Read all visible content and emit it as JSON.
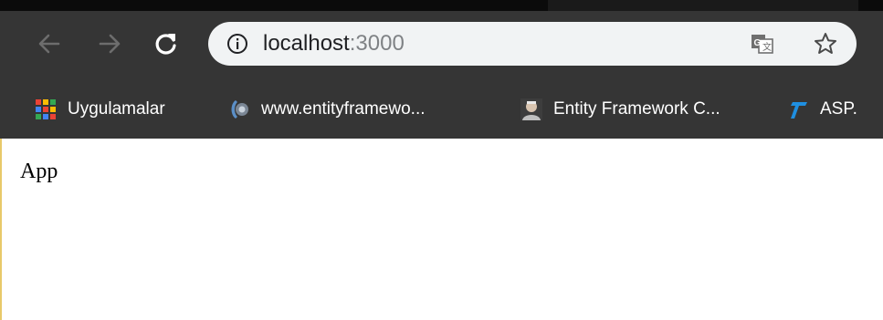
{
  "browser": {
    "address_bar": {
      "host": "localhost",
      "port": ":3000",
      "info_icon": "info-icon",
      "translate_icon": "translate-icon",
      "star_icon": "star-icon"
    },
    "nav": {
      "back_icon": "back-arrow-icon",
      "forward_icon": "forward-arrow-icon",
      "reload_icon": "reload-icon"
    },
    "bookmarks": [
      {
        "label": "Uygulamalar",
        "icon": "apps-grid-icon"
      },
      {
        "label": "www.entityframewo...",
        "icon": "entityframework-icon"
      },
      {
        "label": "Entity Framework C...",
        "icon": "person-avatar-icon"
      },
      {
        "label": "ASP.",
        "icon": "asp-icon"
      }
    ]
  },
  "page": {
    "text": "App"
  },
  "colors": {
    "toolbar_bg": "#353535",
    "omnibox_bg": "#f1f3f4",
    "page_bg": "#ffffff"
  }
}
